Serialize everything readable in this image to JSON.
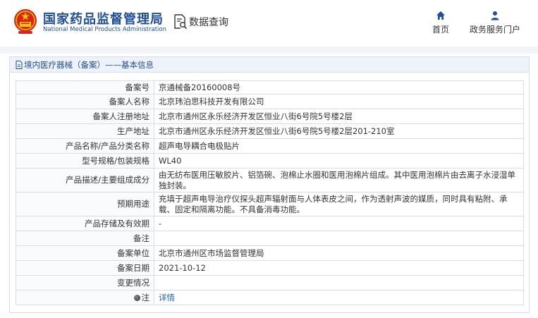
{
  "header": {
    "site_name_cn": "国家药品监督管理局",
    "site_name_en": "National Medical Products Administration",
    "query_label": "数据查询",
    "nav": {
      "home": "首页",
      "services": "政务服务门户"
    },
    "accent_color": "#1f4e9c"
  },
  "panel": {
    "breadcrumb": "境内医疗器械（备案）——基本信息",
    "rows": [
      {
        "label": "备案号",
        "value": "京通械备20160008号"
      },
      {
        "label": "备案人名称",
        "value": "北京玮泊思科技开发有限公司"
      },
      {
        "label": "备案人注册地址",
        "value": "北京市通州区永乐经济开发区恒业八街6号院5号楼2层"
      },
      {
        "label": "生产地址",
        "value": "北京市通州区永乐经济开发区恒业八街6号院5号楼2层201-210室"
      },
      {
        "label": "产品名称/产品分类名称",
        "value": "超声电导耦合电极贴片"
      },
      {
        "label": "型号规格/包装规格",
        "value": "WL40"
      },
      {
        "label": "产品描述/主要组成成分",
        "value": "由无纺布医用压敏胶片、铝箔碗、泡棉止水圈和医用泡棉片组成。其中医用泡棉片由去离子水浸湿单独封装。"
      },
      {
        "label": "预期用途",
        "value": "充填于超声电导治疗仪探头超声辐射面与人体表皮之间，作为透射声波的媒质，同时具有粘附、承载、固定和隔离功能。不具备消毒功能。"
      },
      {
        "label": "产品存储及有效期",
        "value": "-"
      },
      {
        "label": "备注",
        "value": ""
      },
      {
        "label": "备案单位",
        "value": "北京市通州区市场监督管理局"
      },
      {
        "label": "备案日期",
        "value": "2021-10-12"
      },
      {
        "label": "变更情况",
        "value": ""
      },
      {
        "label": "注",
        "value": "详情"
      }
    ]
  }
}
